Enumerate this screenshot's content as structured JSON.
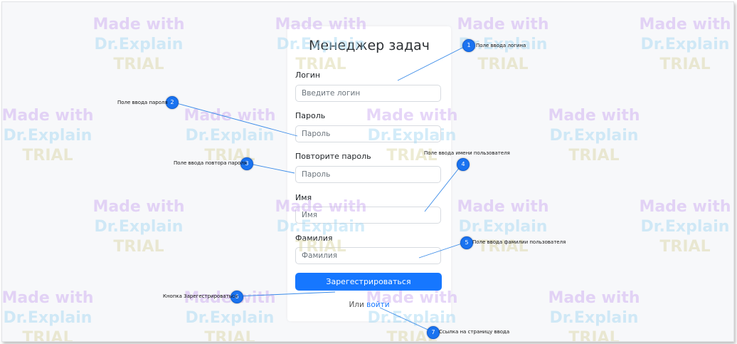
{
  "app": {
    "title": "Менеджер задач"
  },
  "form": {
    "login_label": "Логин",
    "login_placeholder": "Введите логин",
    "password_label": "Пароль",
    "password_placeholder": "Пароль",
    "repeat_label": "Повторите пароль",
    "repeat_placeholder": "Пароль",
    "name_label": "Имя",
    "name_placeholder": "Имя",
    "surname_label": "Фамилия",
    "surname_placeholder": "Фамилия",
    "register_button": "Зарегестрироваться",
    "or_text": "Или ",
    "login_link": "войти"
  },
  "callouts": [
    {
      "num": "1",
      "text": "Поле ввода логина"
    },
    {
      "num": "2",
      "text": "Поле ввода пароля"
    },
    {
      "num": "3",
      "text": "Поле ввода повтора пароля"
    },
    {
      "num": "4",
      "text": "Поле ввода имени пользователя"
    },
    {
      "num": "5",
      "text": "Поле ввода фамилии пользователя"
    },
    {
      "num": "6",
      "text": "Кнопка Зарегестрироваться"
    },
    {
      "num": "7",
      "text": "Ссылка на страницу ввода"
    }
  ],
  "watermark": {
    "line1": "Made with",
    "line2": "Dr.Explain",
    "line3": "TRIAL"
  },
  "colors": {
    "accent": "#1677ff",
    "badge": "#1a73f0",
    "background": "#f7f8fa"
  }
}
